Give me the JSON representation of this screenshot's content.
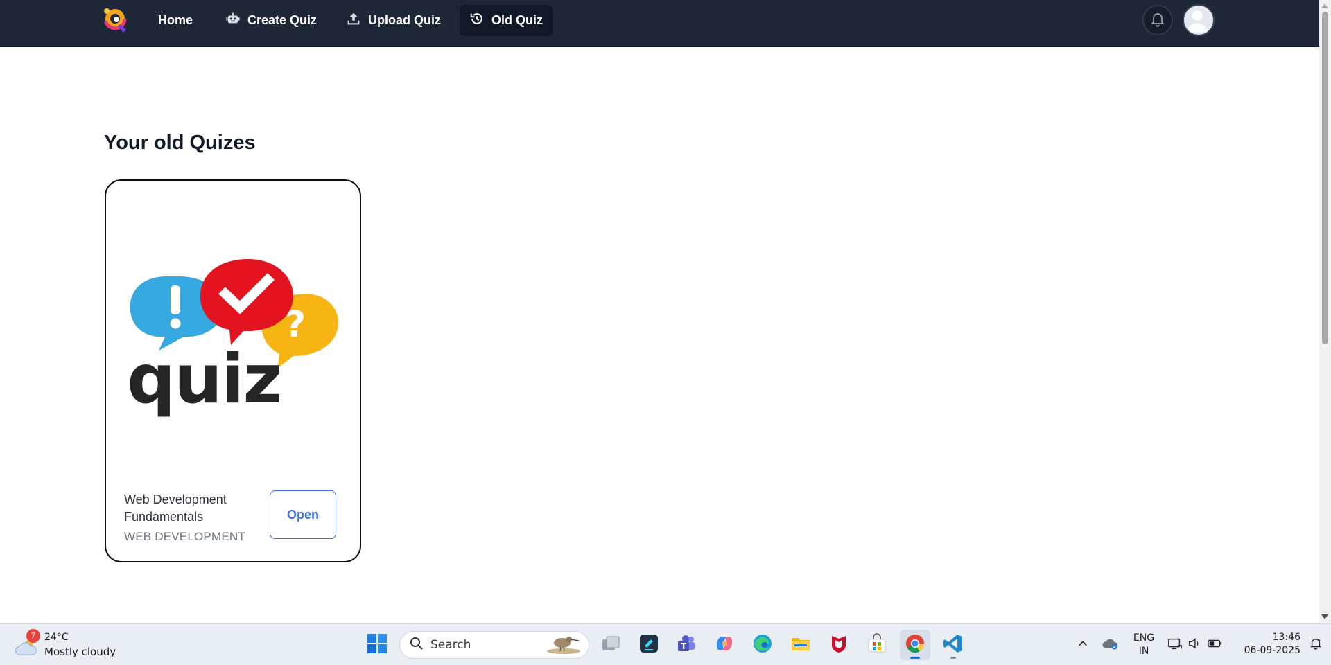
{
  "nav": {
    "home": "Home",
    "create_quiz": "Create Quiz",
    "upload_quiz": "Upload Quiz",
    "old_quiz": "Old Quiz"
  },
  "page": {
    "title": "Your old Quizes"
  },
  "quizzes": [
    {
      "title": "Web Development Fundamentals",
      "category": "WEB DEVELOPMENT",
      "open_label": "Open",
      "image_text": "quiz"
    }
  ],
  "taskbar": {
    "weather_badge": "7",
    "weather_temp": "24°C",
    "weather_desc": "Mostly cloudy",
    "search_label": "Search",
    "language_line1": "ENG",
    "language_line2": "IN",
    "time": "13:46",
    "date": "06-09-2025"
  },
  "colors": {
    "nav_bg": "#1e2737",
    "nav_active_bg": "#111827",
    "accent_blue": "#3b6fd9",
    "bubble_blue": "#37a9e1",
    "bubble_red": "#e3141f",
    "bubble_yellow": "#f7b514"
  },
  "icons": {
    "nav_home": "none",
    "nav_create": "robot-icon",
    "nav_upload": "upload-icon",
    "nav_old": "history-icon",
    "bell": "bell-icon",
    "avatar": "user-avatar-icon"
  }
}
